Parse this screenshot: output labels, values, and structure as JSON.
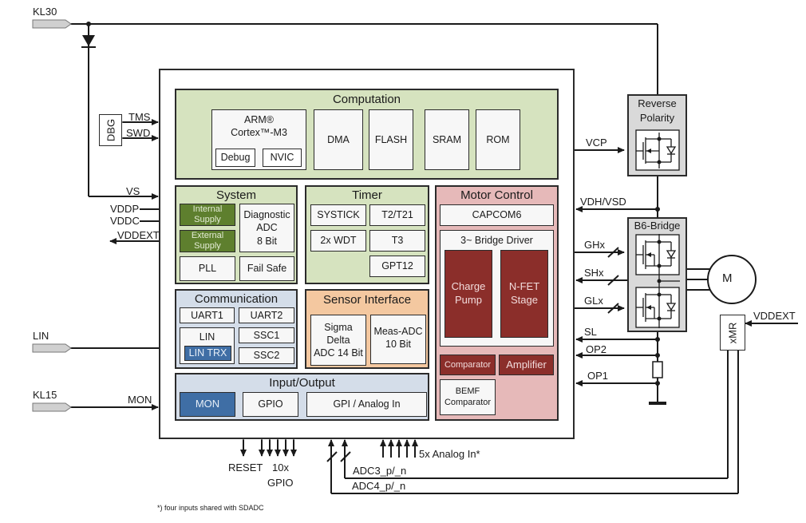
{
  "external_pins": {
    "kl30": "KL30",
    "lin": "LIN",
    "kl15": "KL15"
  },
  "left_signals": {
    "tms": "TMS",
    "swd": "SWD",
    "dbg": "DBG",
    "vs": "VS",
    "vddp": "VDDP",
    "vddc": "VDDC",
    "vddext": "VDDEXT",
    "mon": "MON"
  },
  "computation": {
    "title": "Computation",
    "cpu_line1": "ARM®",
    "cpu_line2": "Cortex™-M3",
    "debug": "Debug",
    "nvic": "NVIC",
    "dma": "DMA",
    "flash": "FLASH",
    "sram": "SRAM",
    "rom": "ROM"
  },
  "system": {
    "title": "System",
    "internal_supply": "Internal Supply",
    "external_supply": "External Supply",
    "diag_adc_l1": "Diagnostic",
    "diag_adc_l2": "ADC",
    "diag_adc_l3": "8 Bit",
    "pll": "PLL",
    "fail_safe": "Fail Safe"
  },
  "timer": {
    "title": "Timer",
    "systick": "SYSTICK",
    "t2": "T2/T21",
    "wdt": "2x WDT",
    "t3": "T3",
    "gpt12": "GPT12"
  },
  "motor_control": {
    "title": "Motor Control",
    "capcom6": "CAPCOM6",
    "bridge_driver": "3~  Bridge Driver",
    "charge_pump_l1": "Charge",
    "charge_pump_l2": "Pump",
    "nfet_l1": "N-FET",
    "nfet_l2": "Stage",
    "comparator": "Comparator",
    "amplifier": "Amplifier",
    "bemf_l1": "BEMF",
    "bemf_l2": "Comparator"
  },
  "communication": {
    "title": "Communication",
    "uart1": "UART1",
    "uart2": "UART2",
    "lin": "LIN",
    "lin_trx": "LIN TRX",
    "ssc1": "SSC1",
    "ssc2": "SSC2"
  },
  "sensor_interface": {
    "title": "Sensor Interface",
    "sd_l1": "Sigma Delta",
    "sd_l2": "ADC 14 Bit",
    "meas_l1": "Meas-ADC",
    "meas_l2": "10 Bit"
  },
  "io": {
    "title": "Input/Output",
    "mon": "MON",
    "gpio": "GPIO",
    "gpi": "GPI / Analog In"
  },
  "right_signals": {
    "vcp": "VCP",
    "vdh": "VDH/VSD",
    "ghx": "GHx",
    "shx": "SHx",
    "glx": "GLx",
    "sl": "SL",
    "op2": "OP2",
    "op1": "OP1",
    "vddext": "VDDEXT"
  },
  "external_blocks": {
    "reverse_l1": "Reverse",
    "reverse_l2": "Polarity",
    "b6": "B6-Bridge",
    "motor": "M",
    "xmr": "xMR"
  },
  "bottom_signals": {
    "reset": "RESET",
    "gpio_l1": "10x",
    "gpio_l2": "GPIO",
    "analog_in": "5x Analog In*",
    "adc3": "ADC3_p/_n",
    "adc4": "ADC4_p/_n"
  },
  "footnote": "*) four inputs shared with SDADC"
}
